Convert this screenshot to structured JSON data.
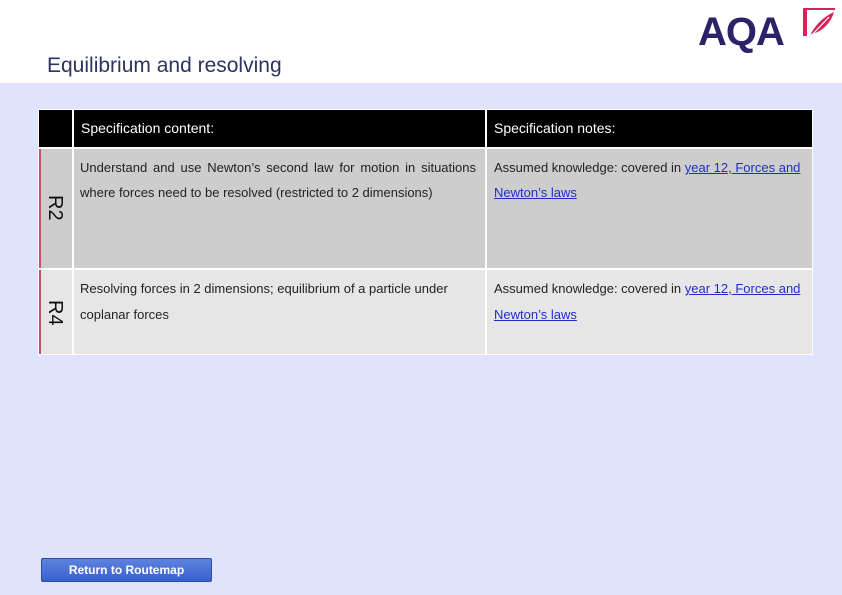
{
  "header": {
    "title": "Equilibrium and resolving",
    "logo_text": "AQA",
    "logo_icon": "aqa-quill-icon",
    "brand_color": "#2f2169",
    "accent_color": "#d6245b"
  },
  "table": {
    "headers": {
      "content": "Specification content:",
      "notes": "Specification notes:"
    },
    "rows": [
      {
        "code": "R2",
        "content": "Understand and use Newton’s second law for motion in situations where forces need to be resolved (restricted to 2 dimensions)",
        "notes_prefix": "Assumed knowledge: covered in ",
        "notes_link": "year 12, Forces and Newton’s laws"
      },
      {
        "code": "R4",
        "content": "Resolving forces in 2 dimensions; equilibrium of a particle under coplanar forces",
        "notes_prefix": "Assumed knowledge: covered in ",
        "notes_link": "year 12, Forces and Newton’s laws"
      }
    ]
  },
  "footer": {
    "return_label": "Return to Routemap"
  }
}
